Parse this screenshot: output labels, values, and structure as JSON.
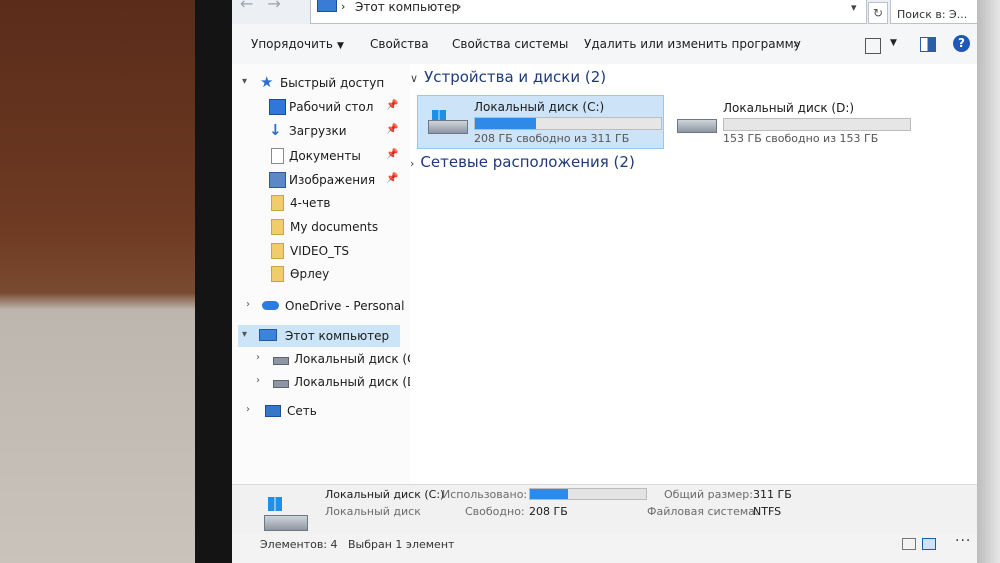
{
  "address": {
    "path": "Этот компьютер",
    "separator": "›",
    "search_placeholder": "Поиск в: Э..."
  },
  "commands": {
    "organize": "Упорядочить",
    "properties": "Свойства",
    "system_properties": "Свойства системы",
    "uninstall": "Удалить или изменить программу",
    "more": "»"
  },
  "nav": {
    "quick_access": "Быстрый доступ",
    "desktop": "Рабочий стол",
    "downloads": "Загрузки",
    "documents": "Документы",
    "pictures": "Изображения",
    "folder1": "4-четв",
    "folder2": "My documents",
    "folder3": "VIDEO_TS",
    "folder4": "Өрлеу",
    "onedrive": "OneDrive - Personal",
    "this_pc": "Этот компьютер",
    "drive_c": "Локальный диск (C:",
    "drive_d": "Локальный диск (D:",
    "network": "Сеть"
  },
  "content": {
    "devices_header": "Устройства и диски (2)",
    "network_header": "Сетевые расположения (2)",
    "drives": [
      {
        "name": "Локальный диск (C:)",
        "free": "208 ГБ свободно из 311 ГБ",
        "used_fraction": 0.33
      },
      {
        "name": "Локальный диск (D:)",
        "free": "153 ГБ свободно из 153 ГБ",
        "used_fraction": 0.0
      }
    ]
  },
  "details": {
    "name": "Локальный диск (C:)",
    "type": "Локальный диск",
    "used_label": "Использовано:",
    "used_fraction": 0.33,
    "free_label": "Свободно:",
    "free_value": "208 ГБ",
    "total_label": "Общий размер:",
    "total_value": "311 ГБ",
    "fs_label": "Файловая система:",
    "fs_value": "NTFS"
  },
  "status": {
    "count": "Элементов: 4",
    "selected": "Выбран 1 элемент"
  },
  "colors": {
    "accent": "#2e8ae6",
    "selection": "#cde3f7",
    "header_text": "#1f3a7a"
  }
}
